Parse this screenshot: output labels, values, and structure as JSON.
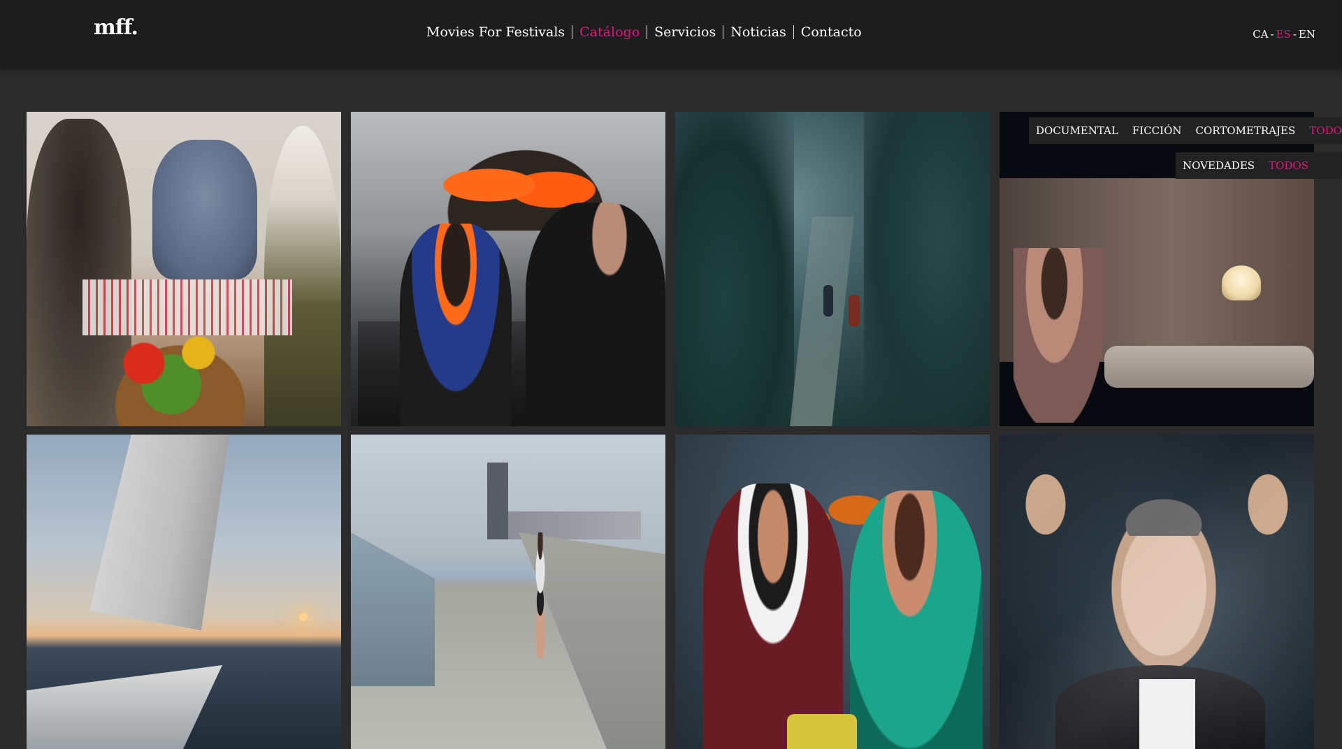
{
  "header": {
    "logo": "mff.",
    "nav": [
      {
        "label": "Movies For Festivals",
        "active": false
      },
      {
        "label": "Catálogo",
        "active": true
      },
      {
        "label": "Servicios",
        "active": false
      },
      {
        "label": "Noticias",
        "active": false
      },
      {
        "label": "Contacto",
        "active": false
      }
    ],
    "languages": [
      {
        "label": "CA",
        "active": false
      },
      {
        "label": "ES",
        "active": true
      },
      {
        "label": "EN",
        "active": false
      }
    ],
    "lang_separator": "-"
  },
  "filters": {
    "type_options": [
      {
        "label": "DOCUMENTAL",
        "active": false
      },
      {
        "label": "FICCIÓN",
        "active": false
      },
      {
        "label": "CORTOMETRAJES",
        "active": false
      },
      {
        "label": "TODOS",
        "active": true
      }
    ],
    "period_options": [
      {
        "label": "NOVEDADES",
        "active": false
      },
      {
        "label": "TODOS",
        "active": true
      }
    ]
  },
  "colors": {
    "accent": "#e3167f",
    "header_bg": "#1d1d1d",
    "page_bg": "#2b2b2b",
    "menu_bg": "#222222"
  },
  "catalog": {
    "tiles": [
      {
        "image": "women-preparing-vegetables"
      },
      {
        "image": "refugees-in-life-jackets"
      },
      {
        "image": "forest-path-aerial"
      },
      {
        "image": "bedroom-scene"
      },
      {
        "image": "sailboat-at-sunset"
      },
      {
        "image": "runner-on-pier"
      },
      {
        "image": "musical-performance"
      },
      {
        "image": "man-under-plastic"
      }
    ]
  }
}
